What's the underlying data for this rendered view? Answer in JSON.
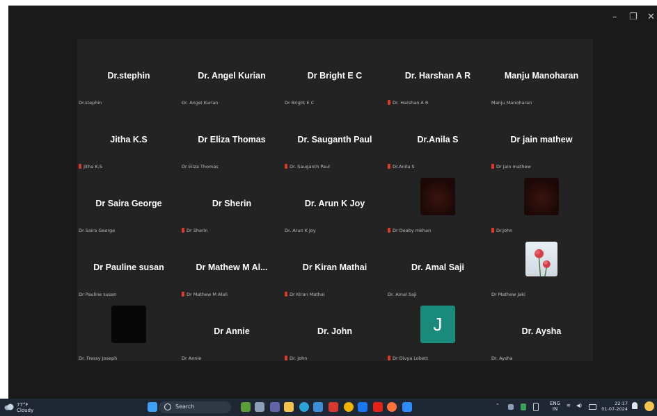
{
  "window": {
    "controls": {
      "minimize": "–",
      "restore": "❐",
      "close": "✕"
    }
  },
  "participants": [
    {
      "name": "Dr.stephin",
      "label": "Dr.stephin",
      "muted": false
    },
    {
      "name": "Dr. Angel Kurian",
      "label": "Dr. Angel Kurian",
      "muted": false
    },
    {
      "name": "Dr Bright E C",
      "label": "Dr Bright E C",
      "muted": false
    },
    {
      "name": "Dr. Harshan A R",
      "label": "Dr. Harshan A R",
      "muted": true
    },
    {
      "name": "Manju Manoharan",
      "label": "Manju Manoharan",
      "muted": false
    },
    {
      "name": "Jitha K.S",
      "label": "Jitha K.S",
      "muted": true
    },
    {
      "name": "Dr Eliza Thomas",
      "label": "Dr Eliza Thomas",
      "muted": false
    },
    {
      "name": "Dr. Sauganth Paul",
      "label": "Dr. Sauganth Paul",
      "muted": true
    },
    {
      "name": "Dr.Anila S",
      "label": "Dr.Anila S",
      "muted": true
    },
    {
      "name": "Dr jain mathew",
      "label": "Dr jain mathew",
      "muted": true
    },
    {
      "name": "Dr Saira George",
      "label": "Dr Saira George",
      "muted": false
    },
    {
      "name": "Dr Sherin",
      "label": "Dr Sherin",
      "muted": true
    },
    {
      "name": "Dr. Arun K Joy",
      "label": "Dr. Arun K Joy",
      "muted": false
    },
    {
      "name": "",
      "label": "Dr Deaby mkhan",
      "muted": true,
      "avatar": "dark-red-photo"
    },
    {
      "name": "",
      "label": "Dr.John",
      "muted": true,
      "avatar": "dark-red-photo"
    },
    {
      "name": "Dr Pauline susan",
      "label": "Dr Pauline susan",
      "muted": false
    },
    {
      "name": "Dr Mathew M Al...",
      "label": "Dr Mathew M Alali",
      "muted": true
    },
    {
      "name": "Dr Kiran Mathai",
      "label": "Dr Kiran Mathai",
      "muted": true
    },
    {
      "name": "Dr. Amal Saji",
      "label": "Dr. Amal Saji",
      "muted": false
    },
    {
      "name": "",
      "label": "Dr Mathew Jaki",
      "muted": false,
      "avatar": "flower-photo"
    },
    {
      "name": "",
      "label": "Dr. Fressy Joseph",
      "muted": false,
      "avatar": "black-photo"
    },
    {
      "name": "Dr Annie",
      "label": "Dr Annie",
      "muted": false
    },
    {
      "name": "Dr. John",
      "label": "Dr. John",
      "muted": true
    },
    {
      "name": "",
      "label": "Dr Divya Lobett",
      "muted": true,
      "avatar": "letter",
      "letter": "J",
      "avatar_color": "#1a8a7a"
    },
    {
      "name": "Dr. Aysha",
      "label": "Dr. Aysha",
      "muted": false
    }
  ],
  "taskbar": {
    "weather": {
      "temp": "77°F",
      "condition": "Cloudy"
    },
    "search_placeholder": "Search",
    "icons": [
      {
        "name": "start-icon",
        "color": "#3fa0f5"
      },
      {
        "name": "widgets-icon",
        "color": "#5a9e3a"
      },
      {
        "name": "task-view-icon",
        "color": "#8aa0b8"
      },
      {
        "name": "teams-icon",
        "color": "#6264a7"
      },
      {
        "name": "file-explorer-icon",
        "color": "#f2c14e"
      },
      {
        "name": "edge-icon",
        "color": "#2aa4d8"
      },
      {
        "name": "store-icon",
        "color": "#3b8fd8"
      },
      {
        "name": "mcafee-icon",
        "color": "#d8382e"
      },
      {
        "name": "chrome-icon",
        "color": "#f0b400"
      },
      {
        "name": "facebook-icon",
        "color": "#1877f2"
      },
      {
        "name": "youtube-icon",
        "color": "#e62117"
      },
      {
        "name": "firefox-icon",
        "color": "#ff7139"
      },
      {
        "name": "zoom-icon",
        "color": "#2d8cff"
      }
    ],
    "tray": {
      "language_top": "ENG",
      "language_bottom": "IN",
      "time": "22:17",
      "date": "01-07-2024"
    }
  }
}
